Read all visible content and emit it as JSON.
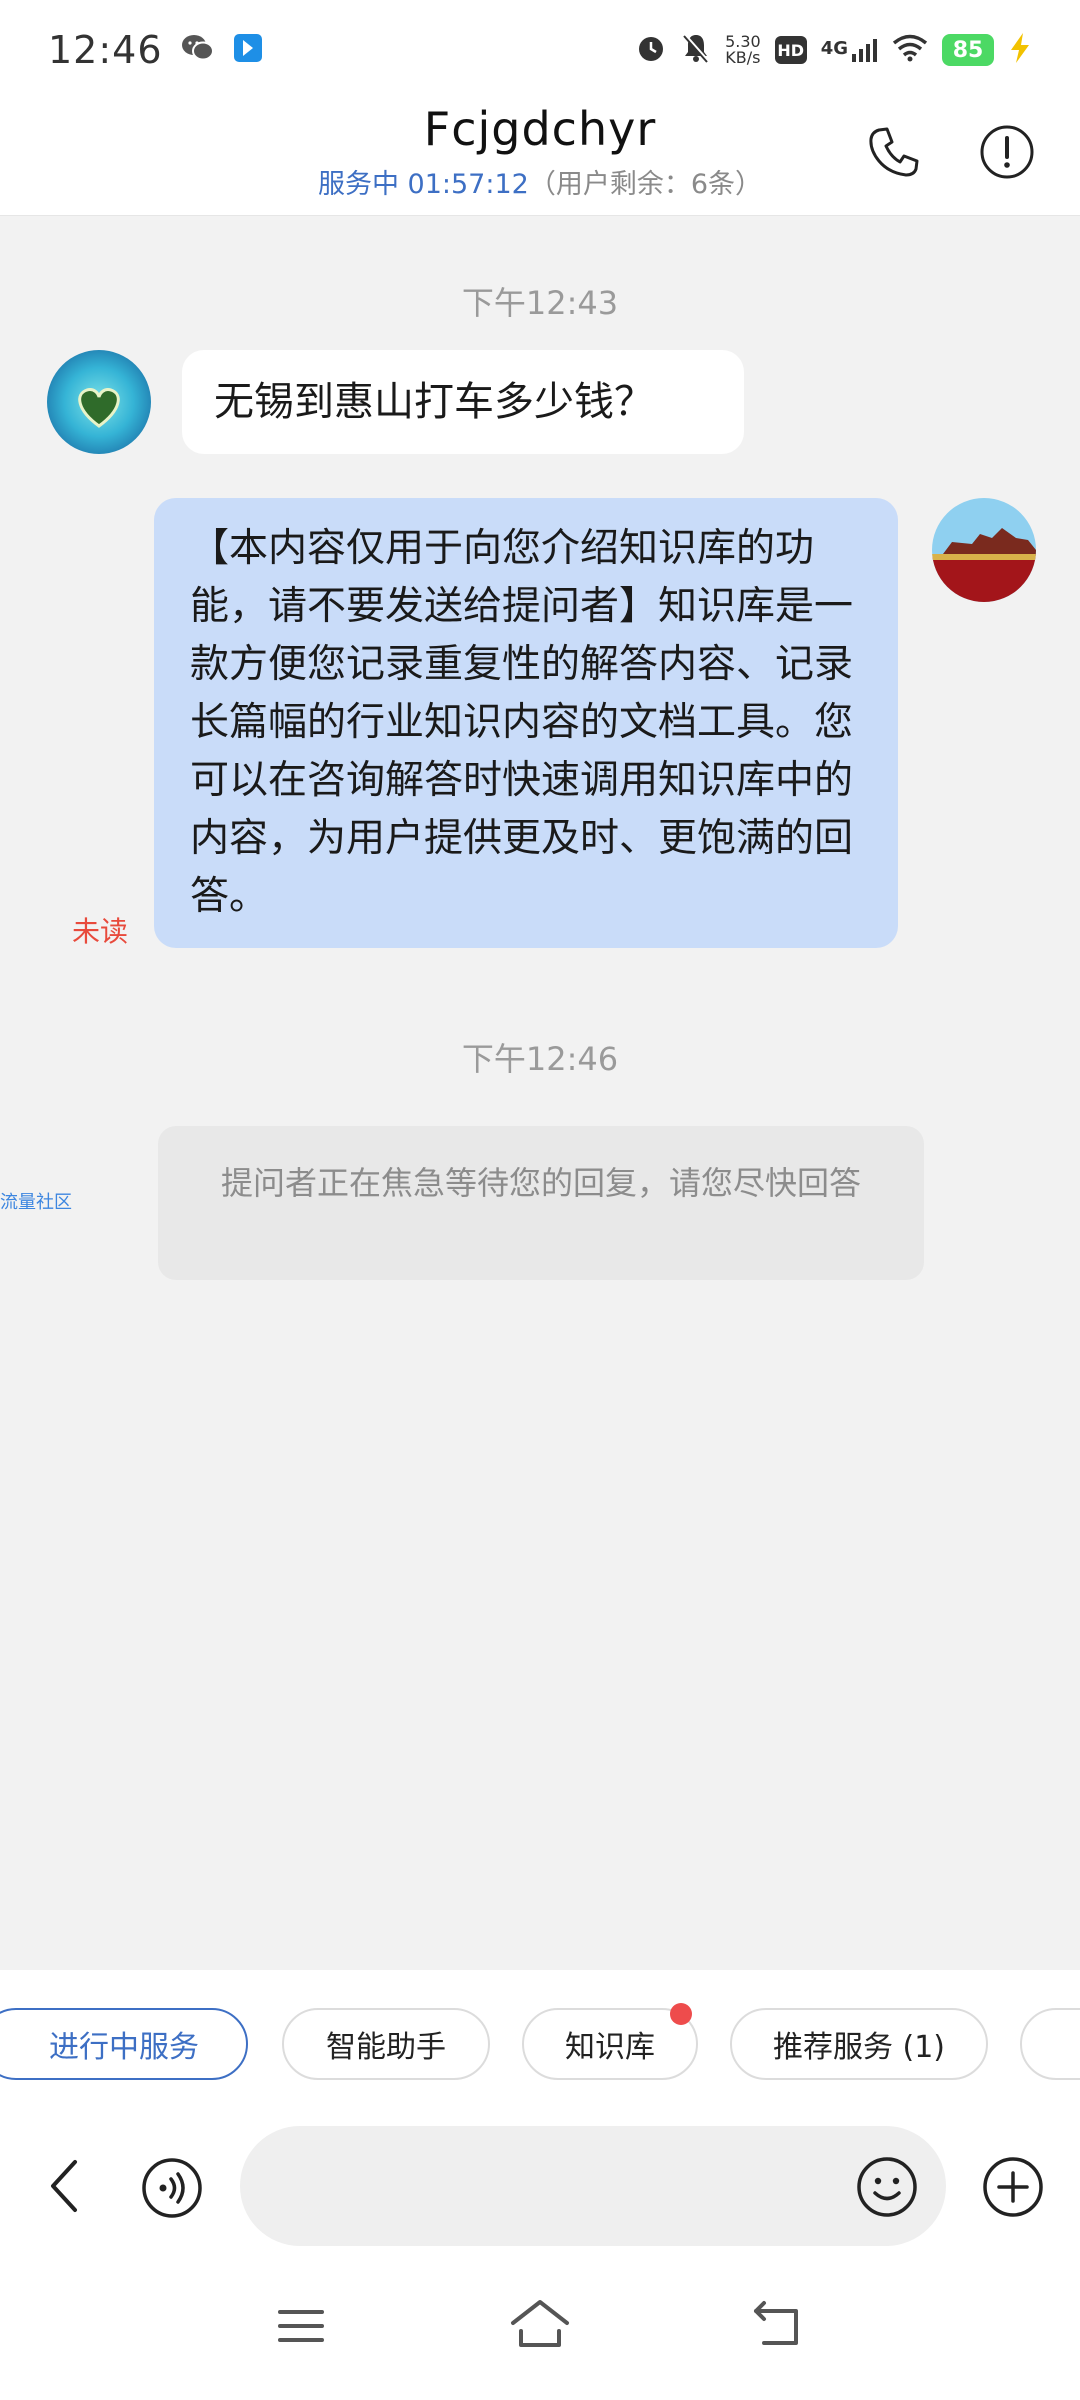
{
  "status_bar": {
    "time": "12:46",
    "speed_value": "5.30",
    "speed_unit": "KB/s",
    "hd": "HD",
    "network": "4G",
    "battery": "85",
    "icons": [
      "wechat-icon",
      "app-notify-icon",
      "alarm-icon",
      "mute-icon",
      "signal-icon",
      "wifi-icon",
      "charging-icon"
    ]
  },
  "header": {
    "title": "Fcjgdchyr",
    "status": "服务中 01:57:12",
    "remaining": "（用户剩余：6条）"
  },
  "chat": {
    "time1": "下午12:43",
    "msg_in": "无锡到惠山打车多少钱？",
    "msg_out": "【本内容仅用于向您介绍知识库的功能，请不要发送给提问者】知识库是一款方便您记录重复性的解答内容、记录长篇幅的行业知识内容的文档工具。您可以在咨询解答时快速调用知识库中的内容，为用户提供更及时、更饱满的回答。",
    "unread": "未读",
    "time2": "下午12:46",
    "notice": "提问者正在焦急等待您的回复，请您尽快回答",
    "side_label": "流量社区"
  },
  "chips": [
    {
      "label": "进行中服务",
      "active": true
    },
    {
      "label": "智能助手",
      "active": false
    },
    {
      "label": "知识库",
      "active": false
    },
    {
      "label": "推荐服务 (1)",
      "active": false
    }
  ],
  "input": {
    "placeholder": ""
  },
  "colors": {
    "accent": "#3d6fc4",
    "bubble_out": "#c9dcf9",
    "unread": "#e84a3c",
    "badge": "#ee4c4c",
    "battery": "#4cd964"
  }
}
